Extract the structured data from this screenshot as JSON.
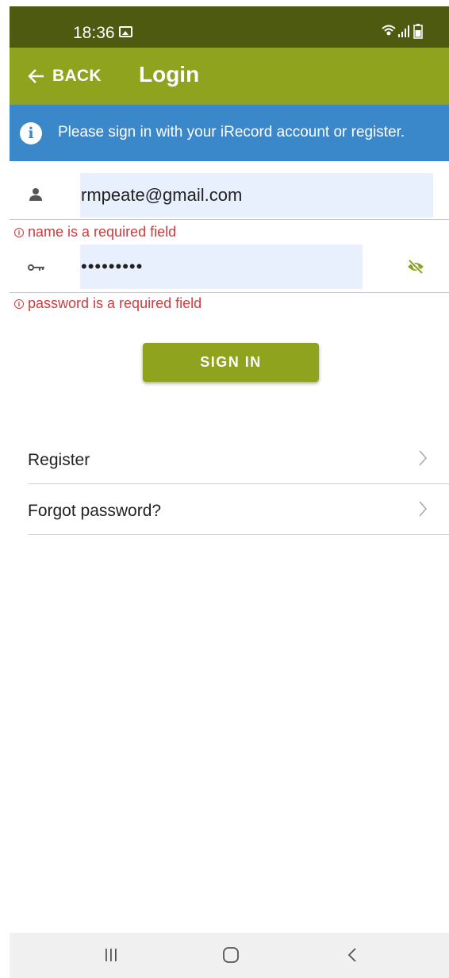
{
  "status_bar": {
    "time": "18:36"
  },
  "app_bar": {
    "back_label": "BACK",
    "title": "Login"
  },
  "info_banner": {
    "text": "Please sign in with your iRecord account or register."
  },
  "form": {
    "username_value": "rmpeate@gmail.com",
    "username_error": "name is a required field",
    "password_value": "•••••••••",
    "password_error": "password is a required field",
    "error_icon": "i",
    "signin_label": "SIGN IN"
  },
  "links": [
    {
      "label": "Register"
    },
    {
      "label": "Forgot password?"
    }
  ],
  "colors": {
    "status_bar": "#4d5a10",
    "primary": "#8fa31f",
    "info": "#3a88c9",
    "error": "#cc3d3d",
    "input_bg": "#e8effd"
  },
  "icons": {
    "back": "arrow-left-icon",
    "info": "info-icon",
    "user": "person-icon",
    "password": "key-icon",
    "visibility": "eye-off-icon",
    "chevron": "chevron-right-icon"
  }
}
